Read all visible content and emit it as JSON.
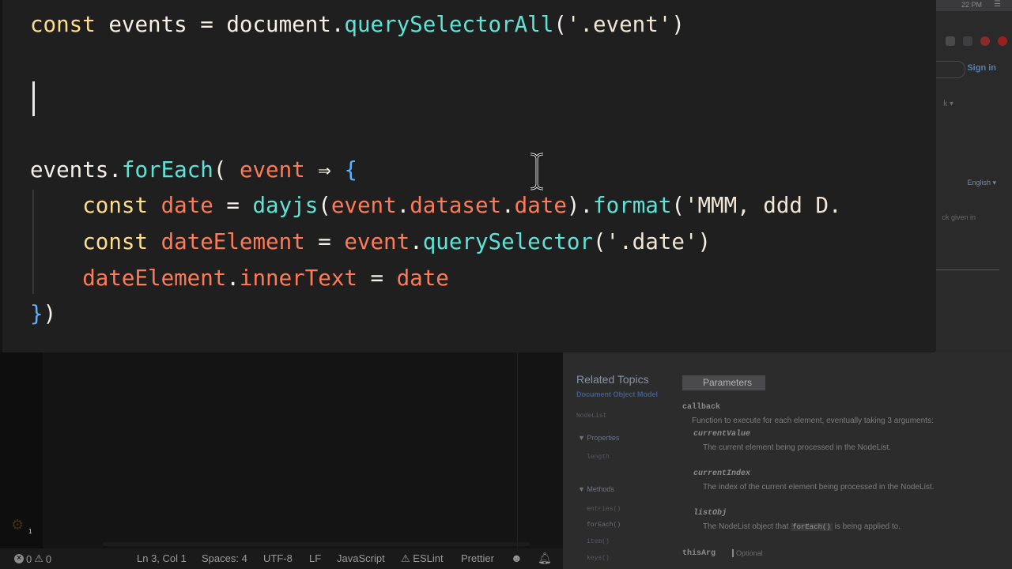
{
  "code": {
    "lines": [
      [
        {
          "t": "const",
          "c": "kw"
        },
        {
          "t": " ",
          "c": "var"
        },
        {
          "t": "events",
          "c": "var"
        },
        {
          "t": " = ",
          "c": "op"
        },
        {
          "t": "document",
          "c": "var"
        },
        {
          "t": ".",
          "c": "punc"
        },
        {
          "t": "querySelectorAll",
          "c": "fn"
        },
        {
          "t": "(",
          "c": "punc"
        },
        {
          "t": "'.event'",
          "c": "str"
        },
        {
          "t": ")",
          "c": "punc"
        }
      ],
      [],
      [],
      [],
      [
        {
          "t": "events",
          "c": "var"
        },
        {
          "t": ".",
          "c": "punc"
        },
        {
          "t": "forEach",
          "c": "fn"
        },
        {
          "t": "( ",
          "c": "punc"
        },
        {
          "t": "event",
          "c": "prm"
        },
        {
          "t": " ⇒ ",
          "c": "op"
        },
        {
          "t": "{",
          "c": "brace"
        }
      ],
      [
        {
          "t": "    const",
          "c": "kw"
        },
        {
          "t": " ",
          "c": "var"
        },
        {
          "t": "date",
          "c": "prm"
        },
        {
          "t": " = ",
          "c": "op"
        },
        {
          "t": "dayjs",
          "c": "fn"
        },
        {
          "t": "(",
          "c": "punc"
        },
        {
          "t": "event",
          "c": "prm"
        },
        {
          "t": ".",
          "c": "punc"
        },
        {
          "t": "dataset",
          "c": "prm"
        },
        {
          "t": ".",
          "c": "punc"
        },
        {
          "t": "date",
          "c": "prm"
        },
        {
          "t": ")",
          "c": "punc"
        },
        {
          "t": ".",
          "c": "punc"
        },
        {
          "t": "format",
          "c": "fn"
        },
        {
          "t": "(",
          "c": "punc"
        },
        {
          "t": "'MMM, ddd D.",
          "c": "str"
        }
      ],
      [
        {
          "t": "    const",
          "c": "kw"
        },
        {
          "t": " ",
          "c": "var"
        },
        {
          "t": "dateElement",
          "c": "prm"
        },
        {
          "t": " = ",
          "c": "op"
        },
        {
          "t": "event",
          "c": "prm"
        },
        {
          "t": ".",
          "c": "punc"
        },
        {
          "t": "querySelector",
          "c": "fn"
        },
        {
          "t": "(",
          "c": "punc"
        },
        {
          "t": "'.date'",
          "c": "str"
        },
        {
          "t": ")",
          "c": "punc"
        }
      ],
      [
        {
          "t": "    dateElement",
          "c": "prm"
        },
        {
          "t": ".",
          "c": "punc"
        },
        {
          "t": "innerText",
          "c": "prm"
        },
        {
          "t": " = ",
          "c": "op"
        },
        {
          "t": "date",
          "c": "prm"
        }
      ],
      [
        {
          "t": "}",
          "c": "brace"
        },
        {
          "t": ")",
          "c": "punc"
        }
      ]
    ]
  },
  "status_bar": {
    "errors": "0",
    "warnings": "0",
    "cursor": "Ln 3, Col 1",
    "spaces": "Spaces: 4",
    "encoding": "UTF-8",
    "eol": "LF",
    "language": "JavaScript",
    "eslint": "ESLint",
    "prettier": "Prettier"
  },
  "editor": {
    "settings_badge": "1"
  },
  "browser": {
    "clock": "22 PM",
    "sign_in": "Sign in",
    "lang": "English ▾",
    "caret_k": "k ▾",
    "given_text": "ck given in",
    "related_title": "Related Topics",
    "related_sub": "Document Object Model",
    "sidebar": {
      "nodelist": "NodeList",
      "properties": "▼  Properties",
      "length": "length",
      "methods": "▼  Methods",
      "entries": "entries()",
      "foreach": "forEach()",
      "item": "item()",
      "keys": "keys()"
    },
    "parameters_badge": "Parameters",
    "params": {
      "callback": "callback",
      "callback_desc": "Function to execute for each element, eventually taking 3 arguments:",
      "current_value": "currentValue",
      "current_value_desc": "The current element being processed in the NodeList.",
      "current_index": "currentIndex",
      "current_index_desc": "The index of the current element being processed in the NodeList.",
      "list_obj": "listObj",
      "list_obj_desc_pre": "The NodeList object that",
      "list_obj_code": "forEach()",
      "list_obj_desc_post": "is being applied to.",
      "this_arg": "thisArg",
      "optional": "Optional"
    }
  },
  "colors": {
    "keyword": "#ffde8a",
    "function": "#5ee4d6",
    "parameter": "#ff7a57",
    "brace": "#59b2ff",
    "overlay_bg": "#1f1f20"
  }
}
